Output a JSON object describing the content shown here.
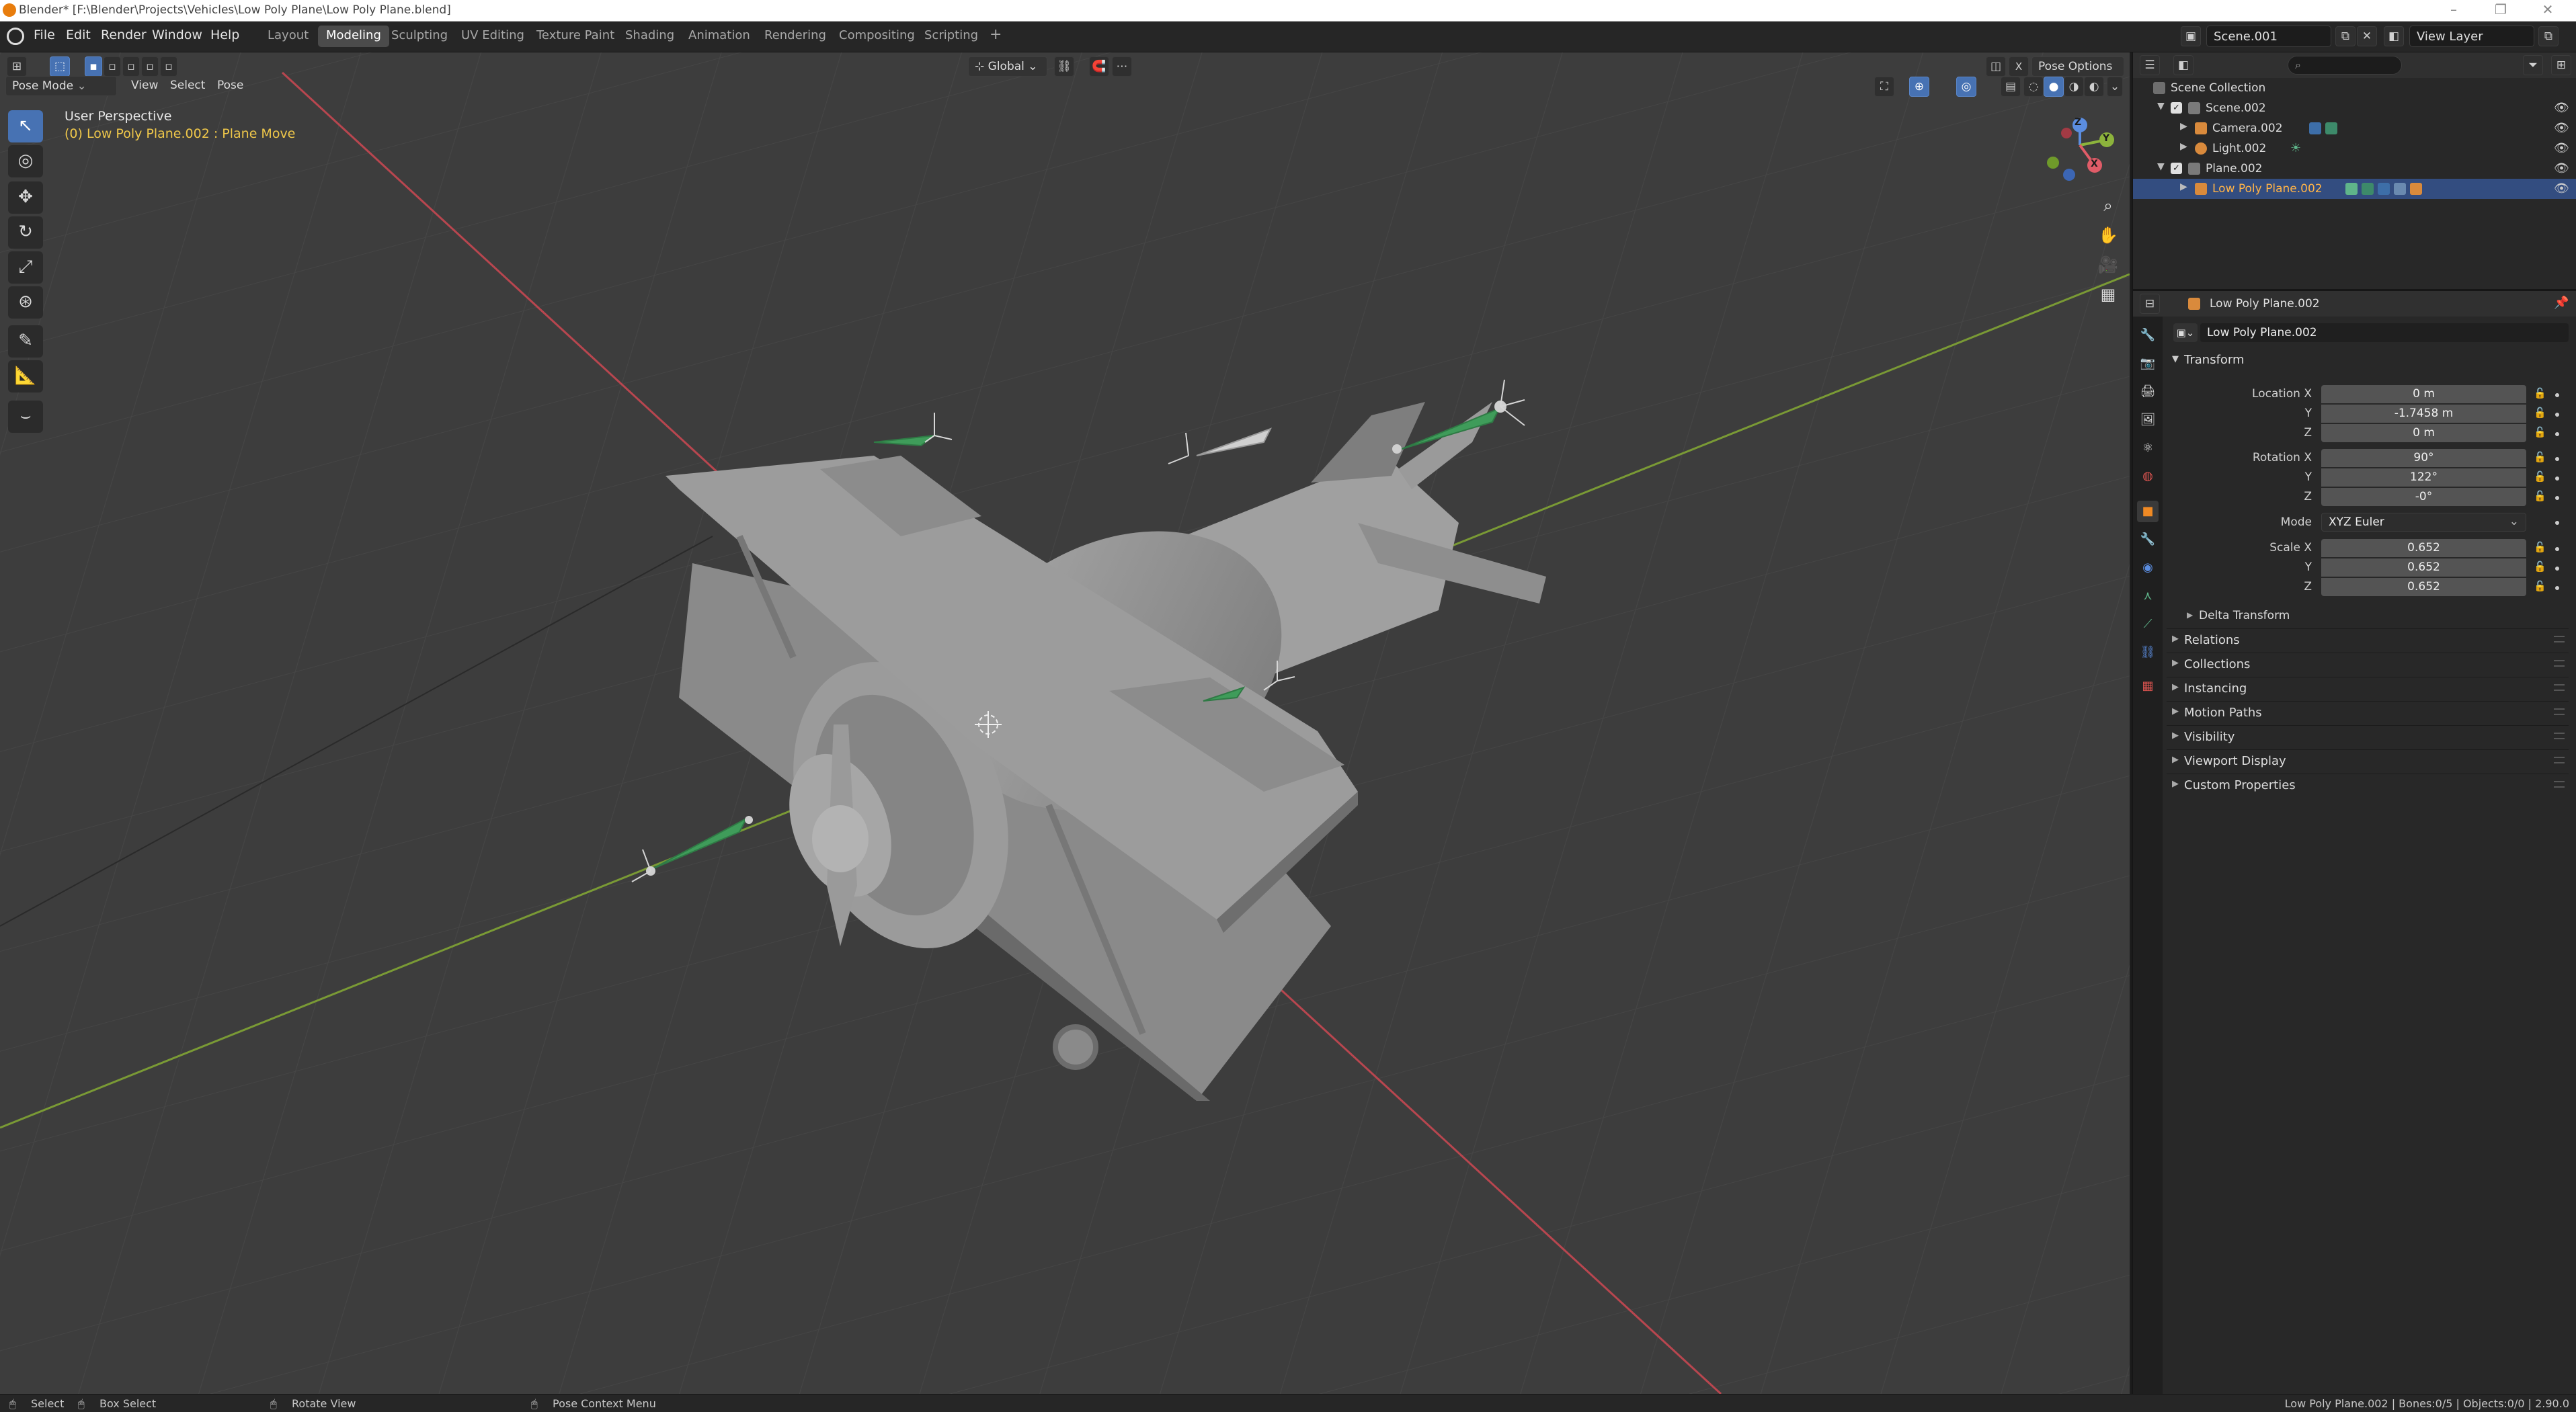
{
  "window": {
    "title": "Blender* [F:\\Blender\\Projects\\Vehicles\\Low Poly Plane\\Low Poly Plane.blend]",
    "controls": [
      "–",
      "❐",
      "✕"
    ]
  },
  "topbar": {
    "menus": [
      "File",
      "Edit",
      "Render",
      "Window",
      "Help"
    ],
    "workspaces": [
      "Layout",
      "Modeling",
      "Sculpting",
      "UV Editing",
      "Texture Paint",
      "Shading",
      "Animation",
      "Rendering",
      "Compositing",
      "Scripting"
    ],
    "active_workspace": "Modeling",
    "add_workspace": "+",
    "scene_name": "Scene.001",
    "view_layer": "View Layer"
  },
  "viewport_header": {
    "mode": "Pose Mode",
    "menus": [
      "View",
      "Select",
      "Pose"
    ],
    "orientation": "Global",
    "close_x": "X",
    "pose_options": "Pose Options"
  },
  "viewport": {
    "perspective_label": "User Perspective",
    "context_label": "(0) Low Poly Plane.002 : Plane Move",
    "gizmo_axes": [
      "Z",
      "Y",
      "X"
    ]
  },
  "toolbar": {
    "tools": [
      "select-box",
      "cursor",
      "move",
      "rotate",
      "scale",
      "transform",
      "annotate",
      "measure",
      "bone-roll"
    ]
  },
  "outliner": {
    "search_placeholder": "",
    "rows": [
      {
        "label": "Scene Collection",
        "indent": 0,
        "type": "collection"
      },
      {
        "label": "Scene.002",
        "indent": 1,
        "type": "collection"
      },
      {
        "label": "Camera.002",
        "indent": 2,
        "type": "camera"
      },
      {
        "label": "Light.002",
        "indent": 2,
        "type": "light"
      },
      {
        "label": "Plane.002",
        "indent": 1,
        "type": "collection"
      },
      {
        "label": "Low Poly Plane.002",
        "indent": 2,
        "type": "armature",
        "selected": true
      }
    ]
  },
  "properties": {
    "header_object": "Low Poly Plane.002",
    "object_name": "Low Poly Plane.002",
    "transform_label": "Transform",
    "location": {
      "label": "Location X",
      "x": "0 m",
      "y": "-1.7458 m",
      "z": "0 m"
    },
    "rotation": {
      "label": "Rotation X",
      "x": "90°",
      "y": "122°",
      "z": "-0°"
    },
    "mode": {
      "label": "Mode",
      "value": "XYZ Euler"
    },
    "scale": {
      "label": "Scale X",
      "x": "0.652",
      "y": "0.652",
      "z": "0.652"
    },
    "axis_y": "Y",
    "axis_z": "Z",
    "delta_transform": "Delta Transform",
    "panels": [
      "Relations",
      "Collections",
      "Instancing",
      "Motion Paths",
      "Visibility",
      "Viewport Display",
      "Custom Properties"
    ]
  },
  "statusbar": {
    "select": "Select",
    "box_select": "Box Select",
    "rotate_view": "Rotate View",
    "context_menu": "Pose Context Menu",
    "stats": "Low Poly Plane.002 | Bones:0/5 | Objects:0/0 | 2.90.0"
  },
  "colors": {
    "accent": "#4772b3",
    "selected_row": "#334d80",
    "viewport_bg": "#3d3d3d",
    "x_axis": "#b8464f",
    "y_axis": "#7a9a35",
    "bone_green": "#3f9c5a"
  }
}
